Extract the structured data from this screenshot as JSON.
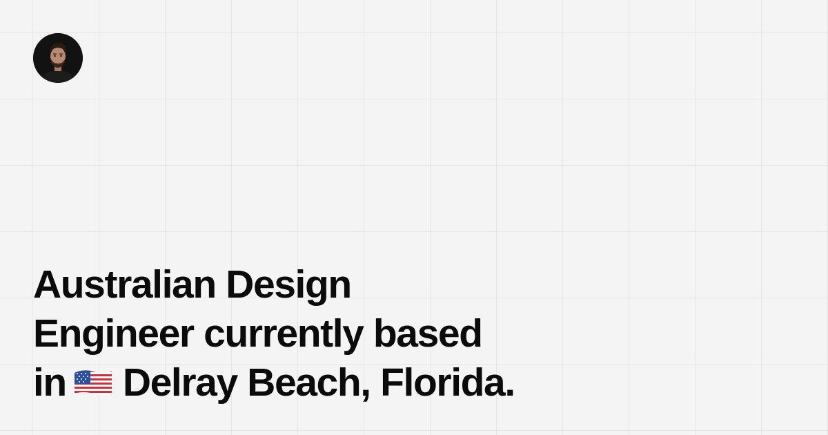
{
  "profile": {
    "avatar": "person-avatar"
  },
  "headline": {
    "line1": "Australian Design",
    "line2": "Engineer currently based",
    "line3_prefix": "in",
    "flag_icon": "us-flag-icon",
    "line3_suffix": "Delray Beach, Florida."
  },
  "colors": {
    "background": "#f4f4f4",
    "grid": "#e6e6e6",
    "text": "#0b0b0b",
    "avatar_bg": "#111111"
  }
}
